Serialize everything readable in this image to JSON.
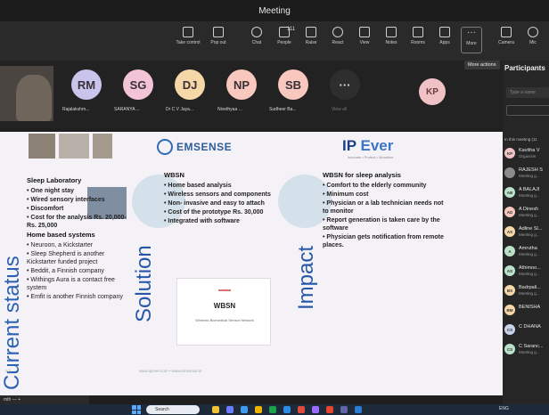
{
  "window": {
    "title": "Meeting"
  },
  "toolbar": {
    "items": [
      {
        "label": "Take control",
        "icon": "take-control-icon"
      },
      {
        "label": "Pop out",
        "icon": "pop-out-icon"
      },
      {
        "label": "Chat",
        "icon": "chat-icon"
      },
      {
        "label": "People",
        "icon": "people-icon",
        "count": "111"
      },
      {
        "label": "Raise",
        "icon": "raise-hand-icon"
      },
      {
        "label": "React",
        "icon": "react-icon"
      },
      {
        "label": "View",
        "icon": "view-icon"
      },
      {
        "label": "Notes",
        "icon": "notes-icon"
      },
      {
        "label": "Rooms",
        "icon": "rooms-icon"
      },
      {
        "label": "Apps",
        "icon": "apps-icon"
      },
      {
        "label": "More",
        "icon": "more-icon"
      },
      {
        "label": "Camera",
        "icon": "camera-icon"
      },
      {
        "label": "Mic",
        "icon": "mic-icon"
      }
    ],
    "tooltip": "More actions"
  },
  "participants_strip": [
    {
      "initials": "RM",
      "name": "Rajalakshm...",
      "color": "#c9c4ec"
    },
    {
      "initials": "SG",
      "name": "SARANYA ...",
      "color": "#f2c4d6"
    },
    {
      "initials": "DJ",
      "name": "Dr C V Jaya...",
      "color": "#f6d8a8"
    },
    {
      "initials": "NP",
      "name": "Nivethyaa ...",
      "color": "#f8c7bd"
    },
    {
      "initials": "SB",
      "name": "Sudheer Ba...",
      "color": "#f8c7bd"
    },
    {
      "initials": "",
      "name": "View all",
      "color": "#2e2e2e"
    }
  ],
  "spotlight": {
    "initials": "KP"
  },
  "slide": {
    "logo_ems": "EMSENSE",
    "logo_ip_a": "IP",
    "logo_ip_b": "Ever",
    "logo_ip_sub": "Innovate • Protect • Monetize",
    "current_label": "Current status",
    "solution_label": "Solution",
    "impact_label": "Impact",
    "col1": {
      "title": "Sleep Laboratory",
      "items": [
        "One night stay",
        "Wired sensory interfaces",
        "Discomfort",
        "Cost for the analysis Rs. 20,000- Rs. 25,000"
      ],
      "title2": "Home based systems",
      "items2": [
        "Neuroon, a Kickstarter",
        "Sleep Shepherd is another Kickstarter funded project",
        "Beddit, a Finnish company",
        "Withings Aura is a contact free system",
        "Emfit is another Finnish company"
      ]
    },
    "col2": {
      "title": "WBSN",
      "items": [
        "Home based analysis",
        "Wireless sensors and components",
        "Non- invasive and easy to attach",
        "Cost of the prototype Rs. 30,000",
        "Integrated with software"
      ],
      "doc_title": "WBSN",
      "doc_sub": "Wireless Biomedical Sensor Network"
    },
    "col3": {
      "title": "WBSN for sleep analysis",
      "items": [
        "Comfort to the elderly community",
        "Minimum cost",
        "Physician or a lab technician needs not to monitor",
        "Report generation is taken care by the software",
        "Physician gets notification from remote places."
      ]
    },
    "footer": "www.ipever.com  •  www.emsense.in",
    "slide_num": "sdi"
  },
  "zoom": {
    "text": "mth  —  +"
  },
  "panel": {
    "heading": "Participants",
    "search_placeholder": "Type a name",
    "section": "In this meeting (11",
    "people": [
      {
        "initials": "KP",
        "name": "Kavitha V",
        "role": "Organizer",
        "color": "#f0c2c6"
      },
      {
        "initials": "",
        "name": "RAJESH S",
        "role": "Meeting g...",
        "color": "#8c8c8c"
      },
      {
        "initials": "AB",
        "name": "A BALAJI",
        "role": "Meeting g...",
        "color": "#b9e2c9"
      },
      {
        "initials": "AD",
        "name": "A Dinesh",
        "role": "Meeting g...",
        "color": "#f8c7bd"
      },
      {
        "initials": "AS",
        "name": "Adline Sl...",
        "role": "Meeting g...",
        "color": "#f6d8a8"
      },
      {
        "initials": "A",
        "name": "Amrutha",
        "role": "Meeting g...",
        "color": "#b9e2c9"
      },
      {
        "initials": "AS",
        "name": "Athimoo...",
        "role": "Meeting g...",
        "color": "#b9e2c9"
      },
      {
        "initials": "BS",
        "name": "Badrpali...",
        "role": "Meeting g...",
        "color": "#f6d8a8"
      },
      {
        "initials": "BM",
        "name": "BENISHA",
        "role": "",
        "color": "#f6d8a8"
      },
      {
        "initials": "CS",
        "name": "C DHANA",
        "role": "",
        "color": "#c9d4ec"
      },
      {
        "initials": "CS",
        "name": "C Saranc...",
        "role": "Meeting g...",
        "color": "#b9e2c9"
      }
    ]
  },
  "taskbar": {
    "search_label": "Search",
    "tray_text": "ENG"
  }
}
